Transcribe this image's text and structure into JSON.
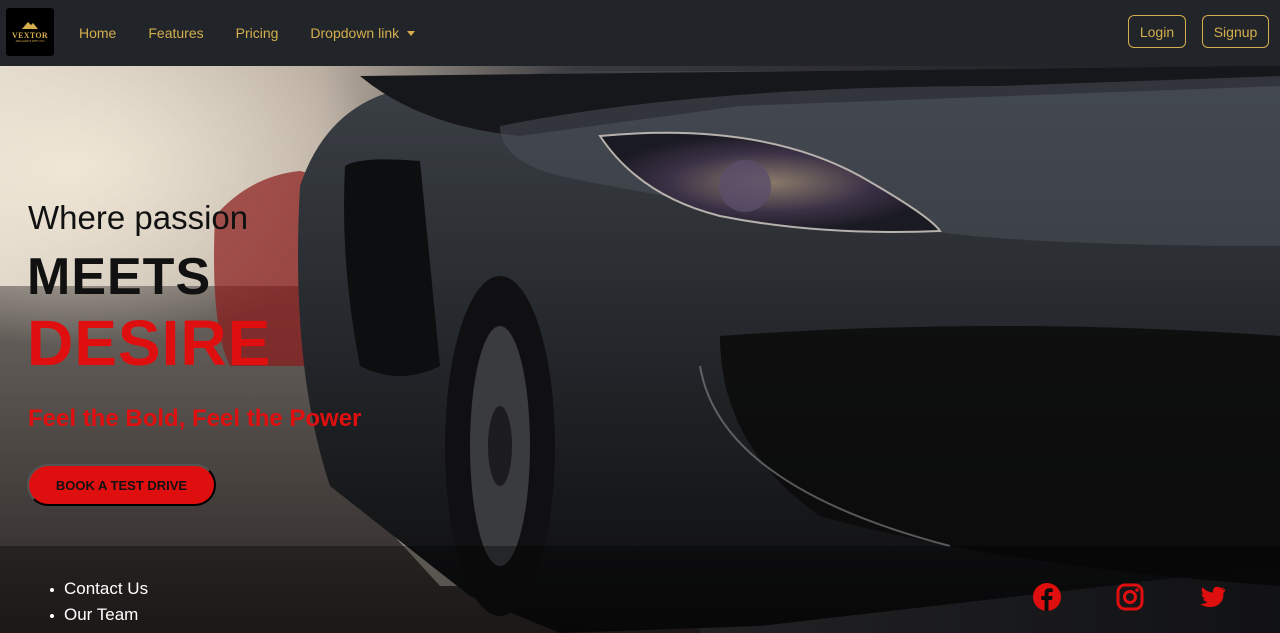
{
  "brand": {
    "name": "VEXTOR",
    "tagline": "ARE ALWAYS WITH YOU",
    "gold": "#d4ad4c"
  },
  "nav": {
    "links": [
      "Home",
      "Features",
      "Pricing",
      "Dropdown link"
    ],
    "login": "Login",
    "signup": "Signup"
  },
  "hero": {
    "line1": "Where passion",
    "line2": "MEETS",
    "line3": "DESIRE",
    "tagline": "Feel the Bold, Feel the Power",
    "cta": "BOOK A TEST DRIVE",
    "accent": "#e00f0f"
  },
  "footer": {
    "links": [
      "Contact Us",
      "Our Team"
    ],
    "social": [
      "facebook-icon",
      "instagram-icon",
      "twitter-icon"
    ]
  }
}
